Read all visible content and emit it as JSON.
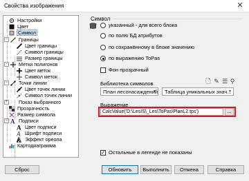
{
  "window": {
    "title": "Свойства изображения",
    "close_glyph": "✕"
  },
  "tree": {
    "items": [
      {
        "label": "Настройки",
        "icon": "gear-icon"
      },
      {
        "label": "Цвет",
        "icon": "color-icon"
      },
      {
        "label": "Символ",
        "icon": "symbol-icon",
        "selected": true
      },
      {
        "label": "Границы",
        "icon": "borders-icon",
        "toggle": "−"
      },
      {
        "label": "Цвет границы",
        "icon": "border-color-icon"
      },
      {
        "label": "Символ границы",
        "icon": "border-symbol-icon"
      },
      {
        "label": "Размер границы",
        "icon": "border-size-icon"
      },
      {
        "label": "Метки полигонов",
        "icon": "polygon-labels-icon",
        "toggle": "−"
      },
      {
        "label": "Цвет меток",
        "icon": "label-color-icon"
      },
      {
        "label": "Символ меток",
        "icon": "label-symbol-icon"
      },
      {
        "label": "Точки линии",
        "icon": "line-points-icon",
        "toggle": "−"
      },
      {
        "label": "Цвет точек линии",
        "icon": "point-color-icon"
      },
      {
        "label": "Символ точек линии",
        "icon": "point-symbol-icon"
      },
      {
        "label": "Показ выбранного",
        "icon": "show-selected-icon",
        "toggle": "+"
      },
      {
        "label": "Прозрачность",
        "icon": "transparency-icon"
      },
      {
        "label": "Размер символа",
        "icon": "symbol-size-icon"
      },
      {
        "label": "Подписи",
        "icon": "captions-icon",
        "toggle": "−"
      },
      {
        "label": "Цвет подписи",
        "icon": "caption-color-icon"
      },
      {
        "label": "Шрифт подписи",
        "icon": "caption-font-icon"
      },
      {
        "label": "Эффект ореола",
        "icon": "halo-effect-icon"
      },
      {
        "label": "Картодиаграмма",
        "icon": "cartodiagram-icon"
      }
    ]
  },
  "symbol_group": {
    "title": "Символ",
    "options": [
      {
        "label": "указанный - для всего блока",
        "selected": false
      },
      {
        "label": "по полю БД атрибутов",
        "selected": false
      },
      {
        "label": "по сохранённому в блоке значению",
        "selected": false
      },
      {
        "label": "по выражению ToPas",
        "selected": true
      }
    ],
    "transparent_bg": {
      "label": "Фон прозрачный",
      "checked": false
    }
  },
  "library": {
    "label": "Библиотека символов",
    "value": "План лесонасаждений",
    "table_value": "Таблица уникальных знач..."
  },
  "expression": {
    "label": "Выражение",
    "value": "CalcValue('D:\\LesIS\\_Les\\ToPas\\PlanL2.tps')",
    "browse_label": "..."
  },
  "legend_check": {
    "label": "Остальные в легенде не показаны",
    "checked": true
  },
  "buttons": {
    "reset": "Сброс",
    "refresh": "Обновить",
    "apply": "Выполнить",
    "cancel": "Отмена",
    "help": "Справка"
  },
  "colors": {
    "highlight": "#e0121b",
    "selection": "#cce4f7",
    "accent": "#0078d7"
  }
}
